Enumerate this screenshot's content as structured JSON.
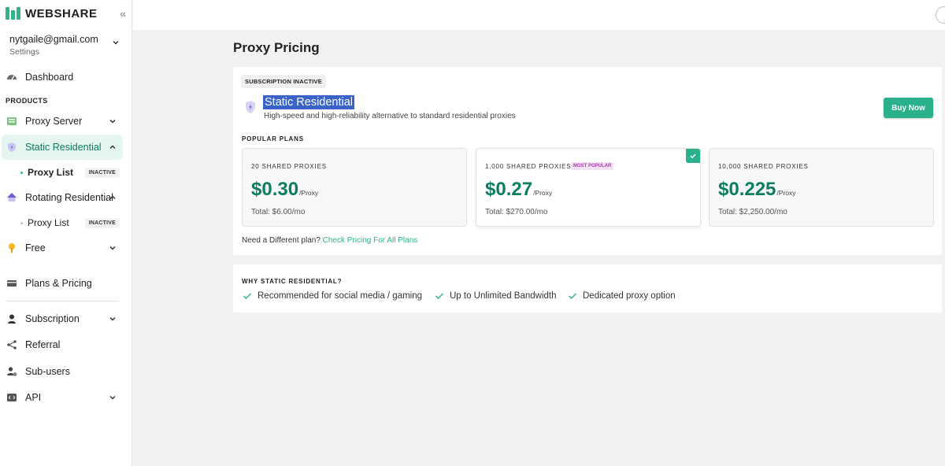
{
  "brand": {
    "name": "WEBSHARE",
    "color": "#2cb48b"
  },
  "account": {
    "email": "nytgaile@gmail.com",
    "settings_label": "Settings"
  },
  "sidebar": {
    "dashboard": "Dashboard",
    "section_products": "PRODUCTS",
    "proxy_server": "Proxy Server",
    "static_residential": "Static Residential",
    "static_proxy_list": "Proxy List",
    "static_proxy_list_badge": "INACTIVE",
    "rotating_residential": "Rotating Residential",
    "rotating_proxy_list": "Proxy List",
    "rotating_proxy_list_badge": "INACTIVE",
    "free": "Free",
    "plans_pricing": "Plans & Pricing",
    "subscription": "Subscription",
    "referral": "Referral",
    "sub_users": "Sub-users",
    "api": "API"
  },
  "page": {
    "title": "Proxy Pricing",
    "status_chip": "SUBSCRIPTION INACTIVE",
    "product_title": "Static Residential",
    "product_desc": "High-speed and high-reliability alternative to standard residential proxies",
    "buy_label": "Buy Now",
    "popular_plans_label": "POPULAR PLANS",
    "plans": [
      {
        "name": "20 SHARED PROXIES",
        "price": "$0.30",
        "per": "/Proxy",
        "total": "Total: $6.00/mo"
      },
      {
        "name": "1,000 SHARED PROXIES",
        "badge": "MOST POPULAR",
        "price": "$0.27",
        "per": "/Proxy",
        "total": "Total: $270.00/mo",
        "selected": true
      },
      {
        "name": "10,000 SHARED PROXIES",
        "price": "$0.225",
        "per": "/Proxy",
        "total": "Total: $2,250.00/mo"
      }
    ],
    "diff_plan_text": "Need a Different plan?",
    "diff_plan_link": "Check Pricing For All Plans",
    "why_label": "WHY STATIC RESIDENTIAL?",
    "why_items": [
      "Recommended for social media / gaming",
      "Up to Unlimited Bandwidth",
      "Dedicated proxy option"
    ]
  },
  "icons": {
    "collapse": "double-chevron-left-icon",
    "dashboard": "speedometer-icon",
    "proxy_server": "server-icon",
    "static_residential": "shield-icon",
    "rotating_residential": "rotate-house-icon",
    "free": "gift-icon",
    "plans_pricing": "credit-card-icon",
    "subscription": "user-icon",
    "referral": "share-icon",
    "sub_users": "users-gear-icon",
    "api": "code-icon"
  },
  "colors": {
    "accent": "#2ab08a",
    "price": "#0d7d5f",
    "highlight": "#3a63c8",
    "popular_badge": "#a23fa6"
  }
}
